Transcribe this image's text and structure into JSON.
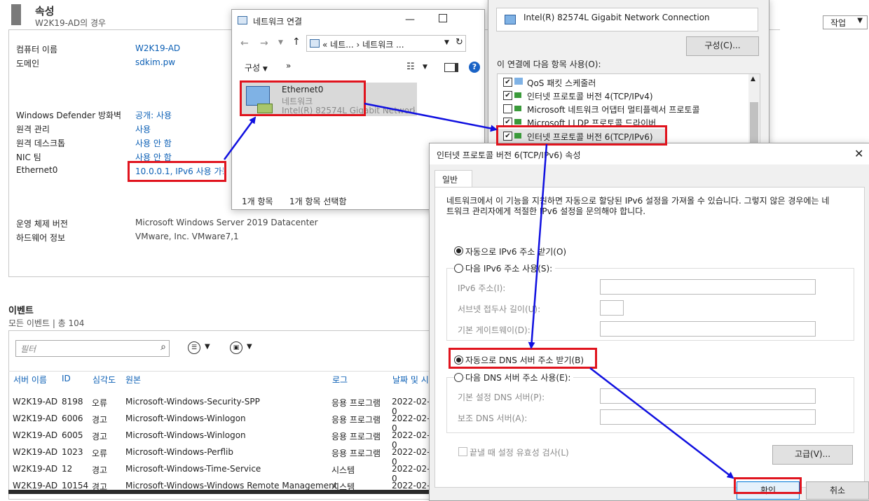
{
  "properties": {
    "title": "속성",
    "subtitle": "W2K19-AD의 경우",
    "task_button": "작업",
    "rows": [
      {
        "label": "컴퓨터 이름",
        "value": "W2K19-AD"
      },
      {
        "label": "도메인",
        "value": "sdkim.pw"
      },
      {
        "label": "Windows Defender 방화벽",
        "value": "공개: 사용"
      },
      {
        "label": "원격 관리",
        "value": "사용"
      },
      {
        "label": "원격 데스크톱",
        "value": "사용 안 함"
      },
      {
        "label": "NIC 팀",
        "value": "사용 안 함"
      },
      {
        "label": "Ethernet0",
        "value": "10.0.0.1, IPv6 사용 가능"
      },
      {
        "label": "운영 체제 버전",
        "value": "Microsoft Windows Server 2019 Datacenter"
      },
      {
        "label": "하드웨어 정보",
        "value": "VMware, Inc. VMware7,1"
      }
    ]
  },
  "events": {
    "title": "이벤트",
    "subtitle": "모든 이벤트 | 총 104",
    "filter_placeholder": "필터",
    "columns": [
      "서버 이름",
      "ID",
      "심각도",
      "원본",
      "로그",
      "날짜 및 시"
    ],
    "rows": [
      [
        "W2K19-AD",
        "8198",
        "오류",
        "Microsoft-Windows-Security-SPP",
        "응용 프로그램",
        "2022-02-0"
      ],
      [
        "W2K19-AD",
        "6006",
        "경고",
        "Microsoft-Windows-Winlogon",
        "응용 프로그램",
        "2022-02-0"
      ],
      [
        "W2K19-AD",
        "6005",
        "경고",
        "Microsoft-Windows-Winlogon",
        "응용 프로그램",
        "2022-02-0"
      ],
      [
        "W2K19-AD",
        "1023",
        "오류",
        "Microsoft-Windows-Perflib",
        "응용 프로그램",
        "2022-02-0"
      ],
      [
        "W2K19-AD",
        "12",
        "경고",
        "Microsoft-Windows-Time-Service",
        "시스템",
        "2022-02-0"
      ],
      [
        "W2K19-AD",
        "10154",
        "경고",
        "Microsoft-Windows-Windows Remote Management",
        "시스템",
        "2022-02-0"
      ]
    ]
  },
  "netconn": {
    "title": "네트워크 연결",
    "address_path": "« 네트...  › 네트워크 ...",
    "organize": "구성",
    "more": "»",
    "item": {
      "name": "Ethernet0",
      "type": "네트워크",
      "adapter": "Intel(R) 82574L Gigabit Network"
    },
    "status_count": "1개 항목",
    "status_selected": "1개 항목 선택함"
  },
  "ethprops": {
    "adapter": "Intel(R) 82574L Gigabit Network Connection",
    "configure": "구성(C)...",
    "uses_label": "이 연결에 다음 항목 사용(O):",
    "items": [
      {
        "label": "QoS 패킷 스케줄러",
        "checked": true
      },
      {
        "label": "인터넷 프로토콜 버전 4(TCP/IPv4)",
        "checked": true
      },
      {
        "label": "Microsoft 네트워크 어댑터 멀티플렉서 프로토콜",
        "checked": false
      },
      {
        "label": "Microsoft LLDP 프로토콜 드라이버",
        "checked": true
      },
      {
        "label": "인터넷 프로토콜 버전 6(TCP/IPv6)",
        "checked": true
      }
    ]
  },
  "ipv6": {
    "title": "인터넷 프로토콜 버전 6(TCP/IPv6) 속성",
    "tab": "일반",
    "description": "네트워크에서 이 기능을 지원하면 자동으로 할당된 IPv6 설정을 가져올 수 있습니다. 그렇지 않은 경우에는 네트워크 관리자에게 적절한 IPv6 설정을 문의해야 합니다.",
    "auto_ip": "자동으로 IPv6 주소 받기(O)",
    "manual_ip": "다음 IPv6 주소 사용(S):",
    "ipv6_addr": "IPv6 주소(I):",
    "prefix": "서브넷 접두사 길이(U):",
    "gateway": "기본 게이트웨이(D):",
    "auto_dns": "자동으로 DNS 서버 주소 받기(B)",
    "manual_dns": "다음 DNS 서버 주소 사용(E):",
    "dns1": "기본 설정 DNS 서버(P):",
    "dns2": "보조 DNS 서버(A):",
    "validate": "끝낼 때 설정 유효성 검사(L)",
    "advanced": "고급(V)...",
    "ok": "확인",
    "cancel": "취소"
  },
  "colors": {
    "accent_red": "#e0141e",
    "arrow_blue": "#1010e0",
    "link_blue": "#0b5fb5"
  }
}
